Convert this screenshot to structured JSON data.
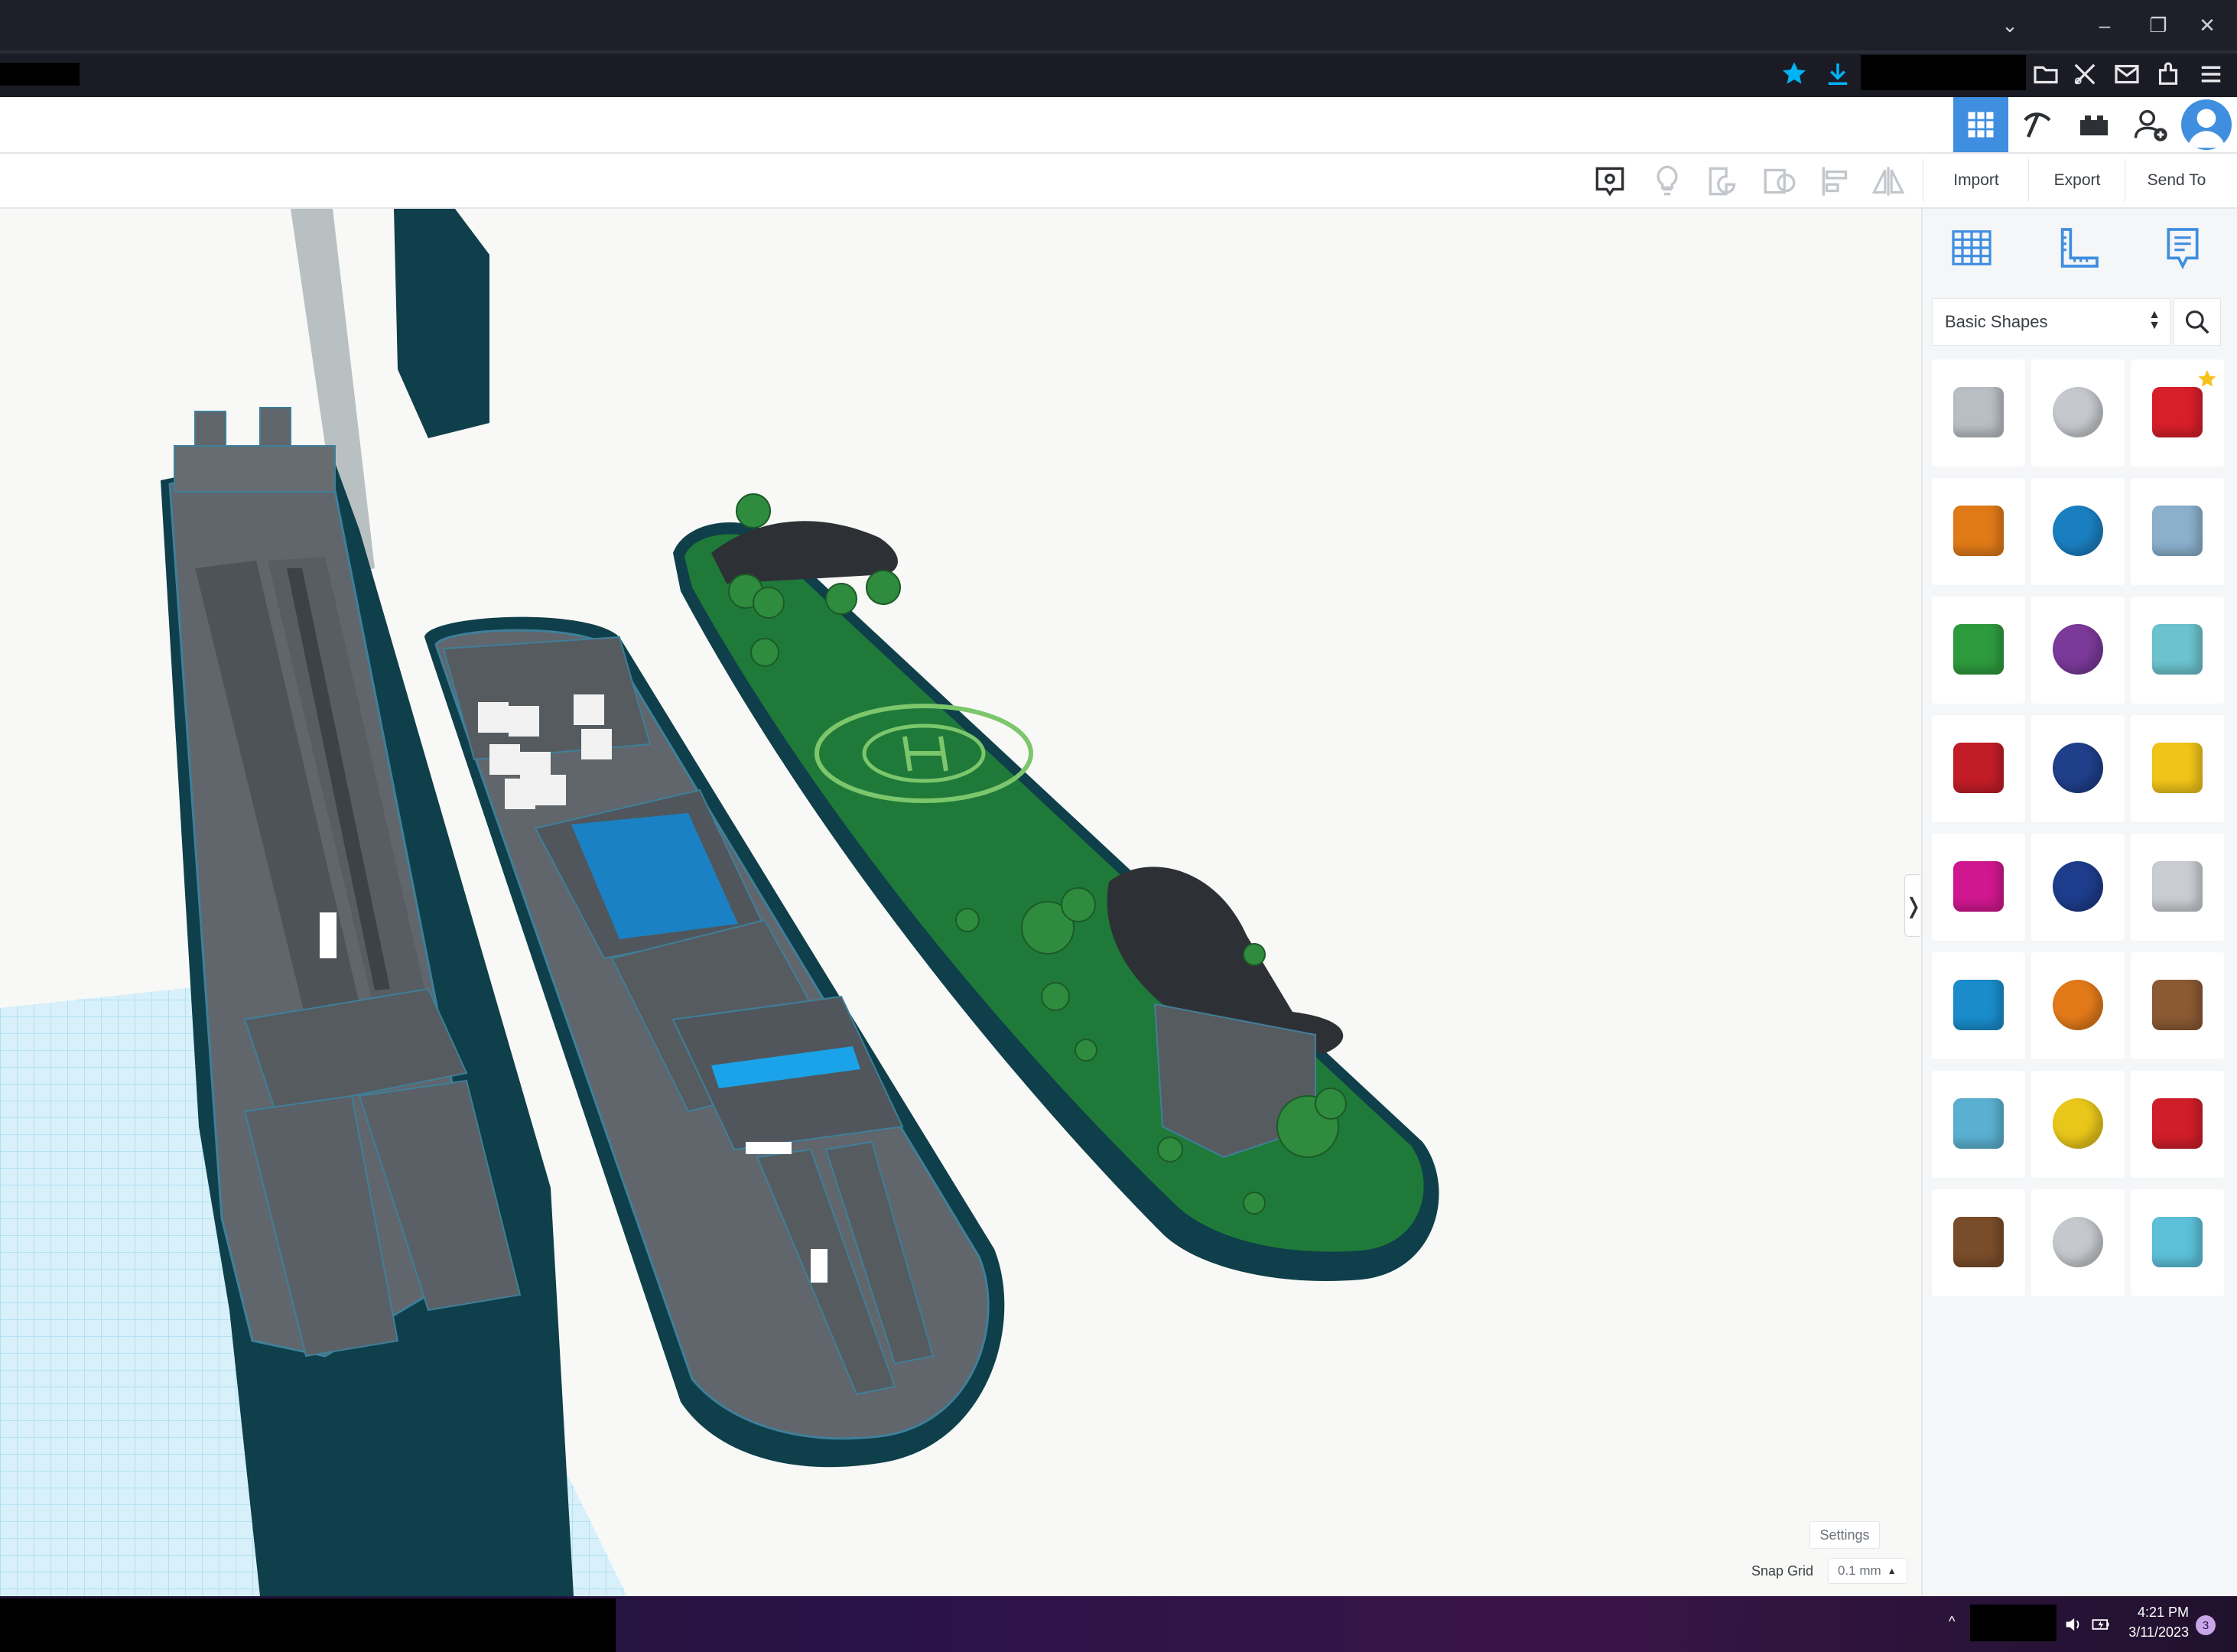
{
  "toolbar": {
    "import_label": "Import",
    "export_label": "Export",
    "send_to_label": "Send To"
  },
  "shapes_panel": {
    "category": "Basic Shapes",
    "shapes": [
      {
        "name": "box-hole-shape",
        "color": "#b9bec4"
      },
      {
        "name": "cylinder-hole-shape",
        "color": "#c5c9cd"
      },
      {
        "name": "box-shape",
        "color": "#d71f2a"
      },
      {
        "name": "cylinder-shape",
        "color": "#e07a18"
      },
      {
        "name": "sphere-shape",
        "color": "#1a7fc1"
      },
      {
        "name": "scribble-shape",
        "color": "#8ab0cc"
      },
      {
        "name": "roof-shape",
        "color": "#2e9a3e"
      },
      {
        "name": "cone-shape",
        "color": "#7b3a9a"
      },
      {
        "name": "round-roof-shape",
        "color": "#6cc3cf"
      },
      {
        "name": "text-shape",
        "color": "#c21d27"
      },
      {
        "name": "wedge-shape",
        "color": "#1f3f8a"
      },
      {
        "name": "pyramid-shape",
        "color": "#f0c419"
      },
      {
        "name": "half-sphere-shape",
        "color": "#d0178f"
      },
      {
        "name": "polygon-shape",
        "color": "#1e3c8c"
      },
      {
        "name": "paraboloid-shape",
        "color": "#c9cdd1"
      },
      {
        "name": "torus-shape",
        "color": "#1a8ccc"
      },
      {
        "name": "tube-shape",
        "color": "#e27a1a"
      },
      {
        "name": "heart-shape",
        "color": "#8b5a34"
      },
      {
        "name": "star-shape",
        "color": "#5ab0d0"
      },
      {
        "name": "star-yellow-shape",
        "color": "#e8c61a"
      },
      {
        "name": "icosahedron-shape",
        "color": "#d01e2a"
      },
      {
        "name": "ring-shape",
        "color": "#7a4d2a"
      },
      {
        "name": "rounded-box-shape",
        "color": "#c5c9cd"
      },
      {
        "name": "diamond-shape",
        "color": "#5cc0d8"
      }
    ]
  },
  "settings": {
    "label": "Settings",
    "snap_grid_label": "Snap Grid",
    "snap_grid_value": "0.1 mm"
  },
  "taskbar": {
    "time": "4:21 PM",
    "date": "3/11/2023",
    "notification_count": "3"
  }
}
